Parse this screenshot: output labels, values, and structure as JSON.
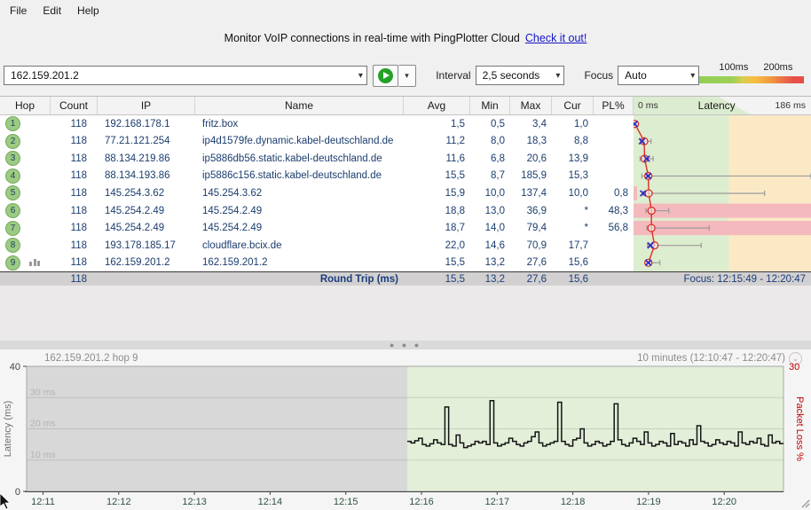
{
  "menu": {
    "items": [
      {
        "label": "File"
      },
      {
        "label": "Edit"
      },
      {
        "label": "Help"
      }
    ]
  },
  "banner": {
    "text": "Monitor VoIP connections in real-time with PingPlotter Cloud",
    "link_text": "Check it out!"
  },
  "toolbar": {
    "target_value": "162.159.201.2",
    "interval_label": "Interval",
    "interval_value": "2,5 seconds",
    "focus_label": "Focus",
    "focus_value": "Auto",
    "scale_legend": {
      "label_100": "100ms",
      "label_200": "200ms"
    }
  },
  "table": {
    "columns": [
      "Hop",
      "Count",
      "IP",
      "Name",
      "Avg",
      "Min",
      "Max",
      "Cur",
      "PL%"
    ],
    "latency_header": {
      "left": "0 ms",
      "center": "Latency",
      "right": "186 ms"
    },
    "latency_scale": {
      "max_ms": 186,
      "green_until_ms": 100
    },
    "hops": [
      {
        "hop": "1",
        "count": "118",
        "ip": "192.168.178.1",
        "name": "fritz.box",
        "avg": "1,5",
        "min": "0,5",
        "max": "3,4",
        "cur": "1,0",
        "pl": "",
        "avg_ms": 1.5,
        "min_ms": 0.5,
        "max_ms": 3.4,
        "cur_ms": 1.0,
        "loss_row": false,
        "loss_sliver": false,
        "has_graph_icon": false
      },
      {
        "hop": "2",
        "count": "118",
        "ip": "77.21.121.254",
        "name": "ip4d1579fe.dynamic.kabel-deutschland.de",
        "avg": "11,2",
        "min": "8,0",
        "max": "18,3",
        "cur": "8,8",
        "pl": "",
        "avg_ms": 11.2,
        "min_ms": 8.0,
        "max_ms": 18.3,
        "cur_ms": 8.8,
        "loss_row": false,
        "loss_sliver": false,
        "has_graph_icon": false
      },
      {
        "hop": "3",
        "count": "118",
        "ip": "88.134.219.86",
        "name": "ip5886db56.static.kabel-deutschland.de",
        "avg": "11,6",
        "min": "6,8",
        "max": "20,6",
        "cur": "13,9",
        "pl": "",
        "avg_ms": 11.6,
        "min_ms": 6.8,
        "max_ms": 20.6,
        "cur_ms": 13.9,
        "loss_row": false,
        "loss_sliver": false,
        "has_graph_icon": false
      },
      {
        "hop": "4",
        "count": "118",
        "ip": "88.134.193.86",
        "name": "ip5886c156.static.kabel-deutschland.de",
        "avg": "15,5",
        "min": "8,7",
        "max": "185,9",
        "cur": "15,3",
        "pl": "",
        "avg_ms": 15.5,
        "min_ms": 8.7,
        "max_ms": 185.9,
        "cur_ms": 15.3,
        "loss_row": false,
        "loss_sliver": false,
        "has_graph_icon": false
      },
      {
        "hop": "5",
        "count": "118",
        "ip": "145.254.3.62",
        "name": "145.254.3.62",
        "avg": "15,9",
        "min": "10,0",
        "max": "137,4",
        "cur": "10,0",
        "pl": "0,8",
        "avg_ms": 15.9,
        "min_ms": 10.0,
        "max_ms": 137.4,
        "cur_ms": 10.0,
        "loss_row": false,
        "loss_sliver": true,
        "has_graph_icon": false
      },
      {
        "hop": "6",
        "count": "118",
        "ip": "145.254.2.49",
        "name": "145.254.2.49",
        "avg": "18,8",
        "min": "13,0",
        "max": "36,9",
        "cur": "*",
        "pl": "48,3",
        "avg_ms": 18.8,
        "min_ms": 13.0,
        "max_ms": 36.9,
        "cur_ms": null,
        "loss_row": true,
        "loss_sliver": false,
        "has_graph_icon": false
      },
      {
        "hop": "7",
        "count": "118",
        "ip": "145.254.2.49",
        "name": "145.254.2.49",
        "avg": "18,7",
        "min": "14,0",
        "max": "79,4",
        "cur": "*",
        "pl": "56,8",
        "avg_ms": 18.7,
        "min_ms": 14.0,
        "max_ms": 79.4,
        "cur_ms": null,
        "loss_row": true,
        "loss_sliver": false,
        "has_graph_icon": false
      },
      {
        "hop": "8",
        "count": "118",
        "ip": "193.178.185.17",
        "name": "cloudflare.bcix.de",
        "avg": "22,0",
        "min": "14,6",
        "max": "70,9",
        "cur": "17,7",
        "pl": "",
        "avg_ms": 22.0,
        "min_ms": 14.6,
        "max_ms": 70.9,
        "cur_ms": 17.7,
        "loss_row": false,
        "loss_sliver": false,
        "has_graph_icon": false
      },
      {
        "hop": "9",
        "count": "118",
        "ip": "162.159.201.2",
        "name": "162.159.201.2",
        "avg": "15,5",
        "min": "13,2",
        "max": "27,6",
        "cur": "15,6",
        "pl": "",
        "avg_ms": 15.5,
        "min_ms": 13.2,
        "max_ms": 27.6,
        "cur_ms": 15.6,
        "loss_row": false,
        "loss_sliver": false,
        "has_graph_icon": true
      }
    ],
    "footer": {
      "count": "118",
      "label": "Round Trip (ms)",
      "avg": "15,5",
      "min": "13,2",
      "max": "27,6",
      "cur": "15,6",
      "focus": "Focus: 12:15:49 - 12:20:47"
    }
  },
  "timeline": {
    "title": "162.159.201.2 hop 9",
    "range_label": "10 minutes (12:10:47 - 12:20:47)",
    "left_axis": {
      "label": "Latency (ms)",
      "top_tick": "40",
      "bottom_tick": "0",
      "inner_labels": [
        "30 ms",
        "20 ms",
        "10 ms"
      ],
      "inner_values": [
        30,
        20,
        10
      ]
    },
    "right_axis": {
      "label": "Packet Loss %",
      "top_tick": "30"
    },
    "x_ticks": [
      "12:11",
      "12:12",
      "12:13",
      "12:14",
      "12:15",
      "12:16",
      "12:17",
      "12:18",
      "12:19",
      "12:20"
    ]
  },
  "chart_data": {
    "type": "line",
    "title": "162.159.201.2 hop 9",
    "ylabel": "Latency (ms)",
    "ylim": [
      0,
      40
    ],
    "right_ylabel": "Packet Loss %",
    "right_ylim": [
      0,
      30
    ],
    "x_range_total": "12:10:47 - 12:20:47",
    "x_range_with_data": "12:15:49 - 12:20:47",
    "values": [
      16,
      15.5,
      16.2,
      17,
      15,
      14.5,
      15.2,
      16.5,
      15.5,
      15,
      27,
      15,
      14.5,
      18,
      15.5,
      14,
      14.5,
      15,
      16,
      15.5,
      16,
      15,
      29,
      15.5,
      14.5,
      15,
      15.5,
      17,
      16,
      15,
      14.5,
      15.5,
      16,
      17.5,
      19,
      15.5,
      14.5,
      15,
      15.5,
      16,
      28.5,
      16,
      15,
      14.5,
      16.5,
      17,
      20,
      15.5,
      14.5,
      15,
      16,
      15.5,
      14.5,
      15,
      16,
      28,
      16.5,
      15,
      14.5,
      15.5,
      17,
      16,
      15,
      19,
      15.5,
      14.5,
      15,
      16,
      15.5,
      14.5,
      18.5,
      15,
      16,
      15.5,
      14.5,
      16.5,
      15,
      21,
      16,
      15.5,
      14.5,
      15,
      16.5,
      15.5,
      15,
      16,
      15.5,
      14.5,
      19,
      15.5,
      15,
      16,
      15.5,
      17,
      15,
      14.5,
      18,
      15.5,
      16,
      15.3
    ]
  },
  "colors": {
    "latency_green_zone": "#ddedcf",
    "latency_orange_zone": "#fbe9c6",
    "packet_loss_bg": "#f4b9bd",
    "avg_line": "#d93025",
    "cur_marker": "#2929c4",
    "range_bar": "#9b9b9b",
    "focus_zone": "#e3efd9",
    "unfocused_zone": "#d8d8d8",
    "packet_loss_axis": "#c00000",
    "x_tick_text": "#2e5340"
  }
}
